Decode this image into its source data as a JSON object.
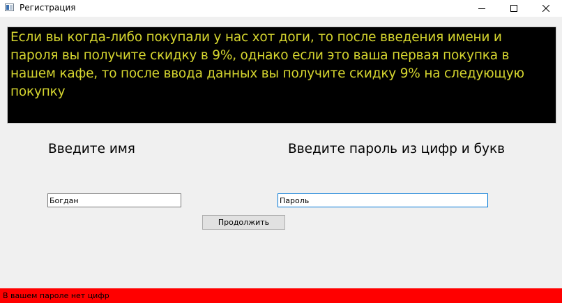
{
  "window": {
    "title": "Регистрация",
    "icon": "app-window-icon",
    "controls": [
      "minimize-icon",
      "maximize-icon",
      "close-icon"
    ]
  },
  "info_panel": {
    "text": "Если вы когда-либо покупали у нас хот доги, то после введения имени и пароля вы получите скидку в 9%, однако если это ваша первая покупка в нашем кафе, то после ввода данных вы получите скидку 9% на следующую покупку",
    "background": "#000000",
    "text_color": "#d6d62f"
  },
  "form": {
    "name_label": "Введите имя",
    "password_label": "Введите пароль из цифр и букв",
    "name_value": "Богдан",
    "password_value": "Пароль",
    "continue_label": "Продолжить"
  },
  "status": {
    "text": "В вашем пароле нет цифр",
    "background": "#ff0000"
  }
}
